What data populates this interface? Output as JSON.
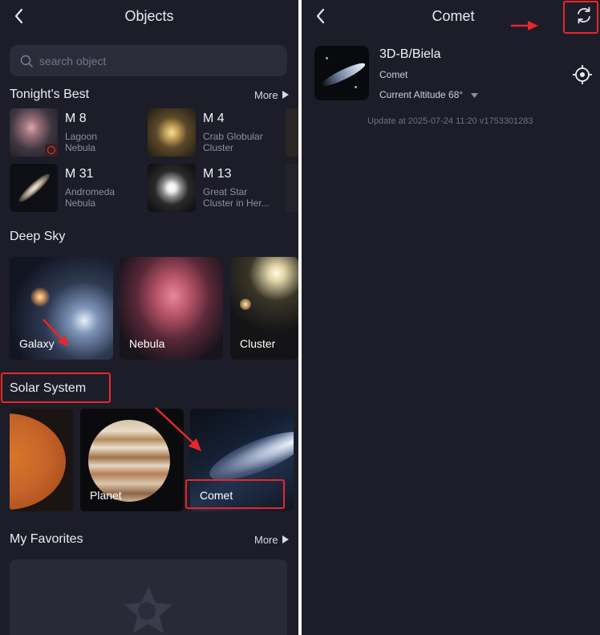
{
  "left": {
    "title": "Objects",
    "search": {
      "placeholder": "search object"
    },
    "tonights_best": {
      "title": "Tonight's Best",
      "more": "More",
      "items": [
        {
          "name": "M 8",
          "line1": "Lagoon",
          "line2": "Nebula"
        },
        {
          "name": "M 4",
          "line1": "Crab Globular",
          "line2": "Cluster"
        },
        {
          "name": "M 31",
          "line1": "Andromeda",
          "line2": "Nebula"
        },
        {
          "name": "M 13",
          "line1": "Great Star",
          "line2": "Cluster in Her..."
        }
      ]
    },
    "deep_sky": {
      "title": "Deep Sky",
      "cards": [
        {
          "label": "Galaxy"
        },
        {
          "label": "Nebula"
        },
        {
          "label": "Cluster"
        }
      ]
    },
    "solar_system": {
      "title": "Solar System",
      "cards": [
        {
          "label": ""
        },
        {
          "label": "Planet"
        },
        {
          "label": "Comet"
        }
      ]
    },
    "favorites": {
      "title": "My Favorites",
      "more": "More"
    }
  },
  "right": {
    "title": "Comet",
    "object": {
      "name": "3D-B/Biela",
      "type": "Comet",
      "altitude": "Current Altitude 68°"
    },
    "update": "Update at 2025-07-24 11:20  v1753301283"
  },
  "colors": {
    "background": "#1c1d28",
    "surface": "#2b2c3a",
    "highlight": "#e8262b"
  },
  "icons": [
    "back-icon",
    "search-icon",
    "play-icon",
    "refresh-icon",
    "locate-icon",
    "dropdown-icon",
    "star-icon"
  ]
}
